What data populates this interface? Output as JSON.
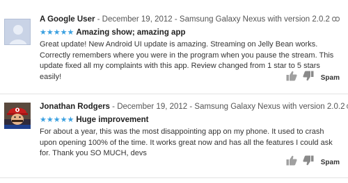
{
  "reviews": [
    {
      "author": "A Google User",
      "meta": " - December 19, 2012 - Samsung Galaxy Nexus with version 2.0.2",
      "stars": "★★★★★",
      "title": "Amazing show; amazing app",
      "body": "Great update! New Android UI update is amazing. Streaming on Jelly Bean works. Correctly remembers where you were in the program when you pause the stream. This update fixed all my complaints with this app. Review changed from 1 star to 5 stars easily!",
      "rating": 5,
      "avatar": "default-user-icon",
      "spam_label": "Spam"
    },
    {
      "author": "Jonathan Rodgers",
      "meta": " - December 19, 2012 - Samsung Galaxy Nexus with version 2.0.2",
      "stars": "★★★★★",
      "title": "Huge improvement",
      "body": "For about a year, this was the most disappointing app on my phone. It used to crash upon opening 100% of the time. It works great now and has all the features I could ask for. Thank you SO MUCH, devs",
      "rating": 5,
      "avatar": "mario-costume-photo",
      "spam_label": "Spam"
    }
  ],
  "colors": {
    "star": "#3aa0e0",
    "divider": "#e3e3e3",
    "thumb": "#9a9a9a"
  }
}
